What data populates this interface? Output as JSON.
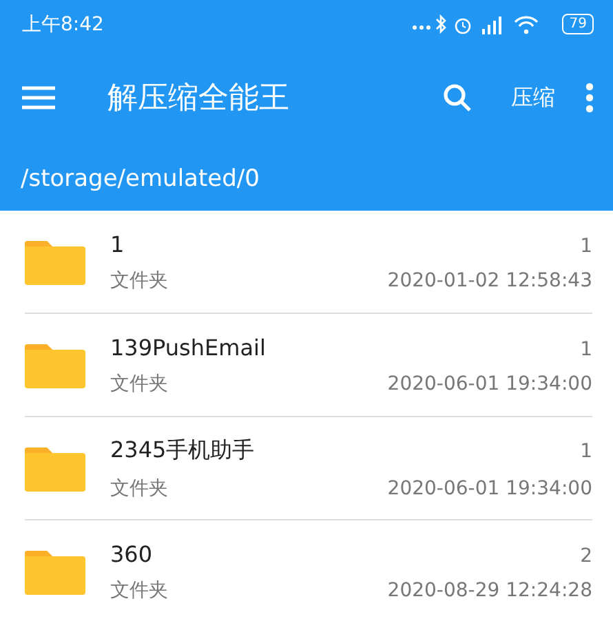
{
  "status_bar": {
    "time": "上午8:42",
    "battery": "79"
  },
  "toolbar": {
    "title": "解压缩全能王",
    "action": "压缩"
  },
  "path": "/storage/emulated/0",
  "files": [
    {
      "name": "1",
      "type": "文件夹",
      "count": "1",
      "date": "2020-01-02 12:58:43"
    },
    {
      "name": "139PushEmail",
      "type": "文件夹",
      "count": "1",
      "date": "2020-06-01 19:34:00"
    },
    {
      "name": "2345手机助手",
      "type": "文件夹",
      "count": "1",
      "date": "2020-06-01 19:34:00"
    },
    {
      "name": "360",
      "type": "文件夹",
      "count": "2",
      "date": "2020-08-29 12:24:28"
    }
  ]
}
